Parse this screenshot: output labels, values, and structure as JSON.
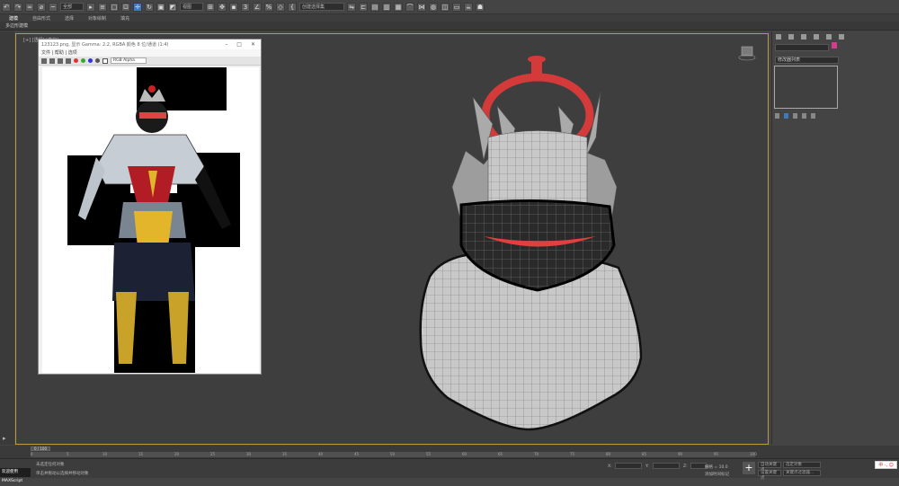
{
  "toolbar": {
    "scope_label": "全部",
    "view_label": "视图",
    "named_sel_label": "创建选择集"
  },
  "ribbon": {
    "tabs": [
      "建模",
      "自由形式",
      "选择",
      "对象绘制",
      "填充"
    ],
    "sub_label": "多边形建模"
  },
  "viewport": {
    "label": "[+] [透视] [真实]"
  },
  "image_window": {
    "title": "123123.png, 显示 Gamma: 2.2, RGBA 颜色 8 位/通道 (1:4)",
    "menu": "文件 | 帮助 | 选项",
    "channel_drop": "RGB Alpha"
  },
  "right_panel": {
    "field1": "",
    "field2": "修改器列表"
  },
  "timeline": {
    "frame_label": "0 / 100",
    "ticks": [
      "0",
      "5",
      "10",
      "15",
      "20",
      "25",
      "30",
      "35",
      "40",
      "45",
      "50",
      "55",
      "60",
      "65",
      "70",
      "75",
      "80",
      "85",
      "90",
      "95",
      "100"
    ]
  },
  "status": {
    "welcome": "欢迎使用 MAXScript",
    "line1": "未选定任何对象",
    "line2": "单击并拖动以选择并移动对象",
    "x_label": "X:",
    "y_label": "Y:",
    "z_label": "Z:",
    "grid_label": "栅格 = 10.0",
    "add_time_tag": "添加时间标记",
    "autokey": "自动关键点",
    "sel_obj": "选定对象",
    "set_key": "设置关键点",
    "key_filter": "关键点过滤器...",
    "ime": "中 ·, ☺"
  },
  "colors": {
    "accent": "#3d7bbf",
    "viewport_border": "#b99a4a",
    "red_mask": "#e04040"
  }
}
